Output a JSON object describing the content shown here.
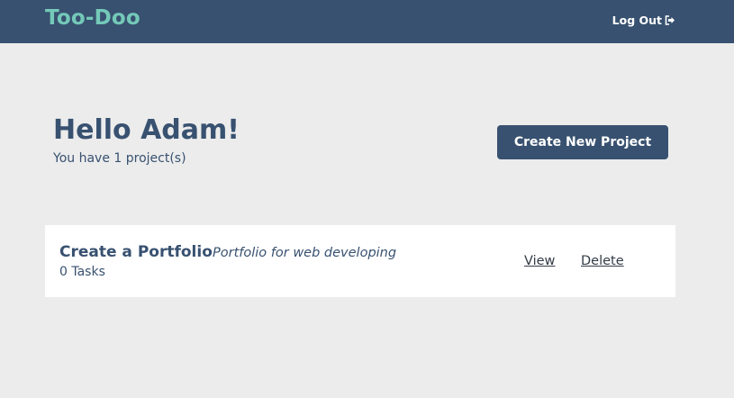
{
  "navbar": {
    "brand": "Too-Doo",
    "logout_label": "Log Out",
    "logout_icon": "sign-out-icon"
  },
  "main": {
    "greeting": "Hello Adam!",
    "project_count_text": "You have 1 project(s)",
    "create_button_label": "Create New Project"
  },
  "projects": [
    {
      "title": "Create a Portfolio",
      "description": "Portfolio for web developing",
      "tasks_text": "0 Tasks",
      "view_label": "View",
      "delete_label": "Delete"
    }
  ],
  "colors": {
    "navbar_bg": "#385170",
    "brand": "#74c9b9",
    "page_bg": "#ececec",
    "card_bg": "#ffffff",
    "text_primary": "#385170"
  }
}
